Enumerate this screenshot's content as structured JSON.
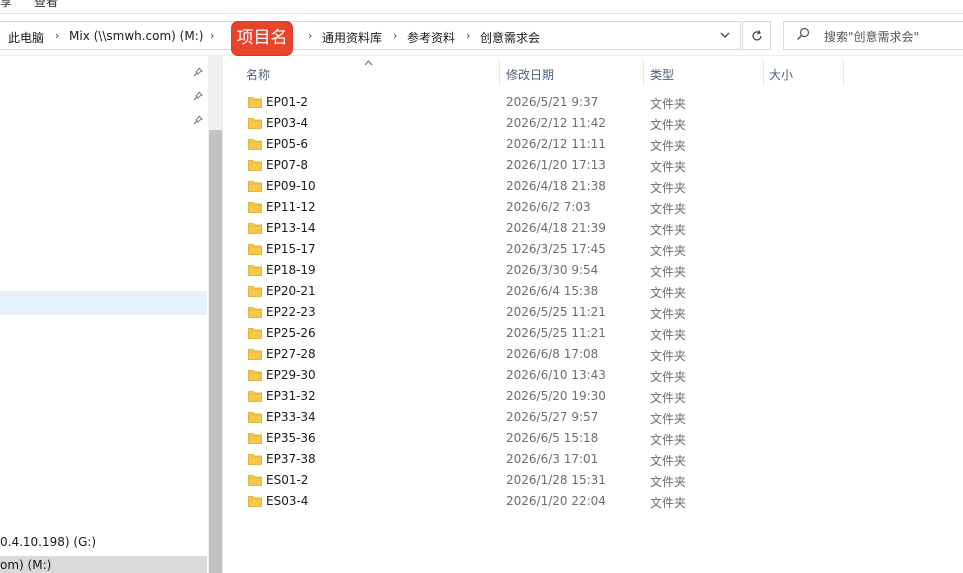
{
  "ribbon": {
    "left_fragment": "享",
    "view_tab": "查看"
  },
  "address": {
    "crumbs": [
      "此电脑",
      "Mix (\\\\smwh.com) (M:)",
      "",
      "通用资料库",
      "参考资料",
      "创意需求会"
    ],
    "refresh_icon": "refresh-icon",
    "dropdown_icon": "chevron-down-icon"
  },
  "overlay_tag": "项目名",
  "search": {
    "placeholder": "搜索\"创意需求会\"",
    "icon": "search-icon"
  },
  "nav": {
    "drive_g": "0.4.10.198) (G:)",
    "drive_m": "om) (M:)"
  },
  "columns": {
    "name": "名称",
    "date": "修改日期",
    "type": "类型",
    "size": "大小"
  },
  "files": [
    {
      "name": "EP01-2",
      "date": "2026/5/21 9:37",
      "type": "文件夹"
    },
    {
      "name": "EP03-4",
      "date": "2026/2/12 11:42",
      "type": "文件夹"
    },
    {
      "name": "EP05-6",
      "date": "2026/2/12 11:11",
      "type": "文件夹"
    },
    {
      "name": "EP07-8",
      "date": "2026/1/20 17:13",
      "type": "文件夹"
    },
    {
      "name": "EP09-10",
      "date": "2026/4/18 21:38",
      "type": "文件夹"
    },
    {
      "name": "EP11-12",
      "date": "2026/6/2 7:03",
      "type": "文件夹"
    },
    {
      "name": "EP13-14",
      "date": "2026/4/18 21:39",
      "type": "文件夹"
    },
    {
      "name": "EP15-17",
      "date": "2026/3/25 17:45",
      "type": "文件夹"
    },
    {
      "name": "EP18-19",
      "date": "2026/3/30 9:54",
      "type": "文件夹"
    },
    {
      "name": "EP20-21",
      "date": "2026/6/4 15:38",
      "type": "文件夹"
    },
    {
      "name": "EP22-23",
      "date": "2026/5/25 11:21",
      "type": "文件夹"
    },
    {
      "name": "EP25-26",
      "date": "2026/5/25 11:21",
      "type": "文件夹"
    },
    {
      "name": "EP27-28",
      "date": "2026/6/8 17:08",
      "type": "文件夹"
    },
    {
      "name": "EP29-30",
      "date": "2026/6/10 13:43",
      "type": "文件夹"
    },
    {
      "name": "EP31-32",
      "date": "2026/5/20 19:30",
      "type": "文件夹"
    },
    {
      "name": "EP33-34",
      "date": "2026/5/27 9:57",
      "type": "文件夹"
    },
    {
      "name": "EP35-36",
      "date": "2026/6/5 15:18",
      "type": "文件夹"
    },
    {
      "name": "EP37-38",
      "date": "2026/6/3 17:01",
      "type": "文件夹"
    },
    {
      "name": "ES01-2",
      "date": "2026/1/28 15:31",
      "type": "文件夹"
    },
    {
      "name": "ES03-4",
      "date": "2026/1/20 22:04",
      "type": "文件夹"
    }
  ],
  "colors": {
    "accent_tag": "#e8432b",
    "folder": "#f7c948",
    "selection": "#e5f1fb"
  }
}
